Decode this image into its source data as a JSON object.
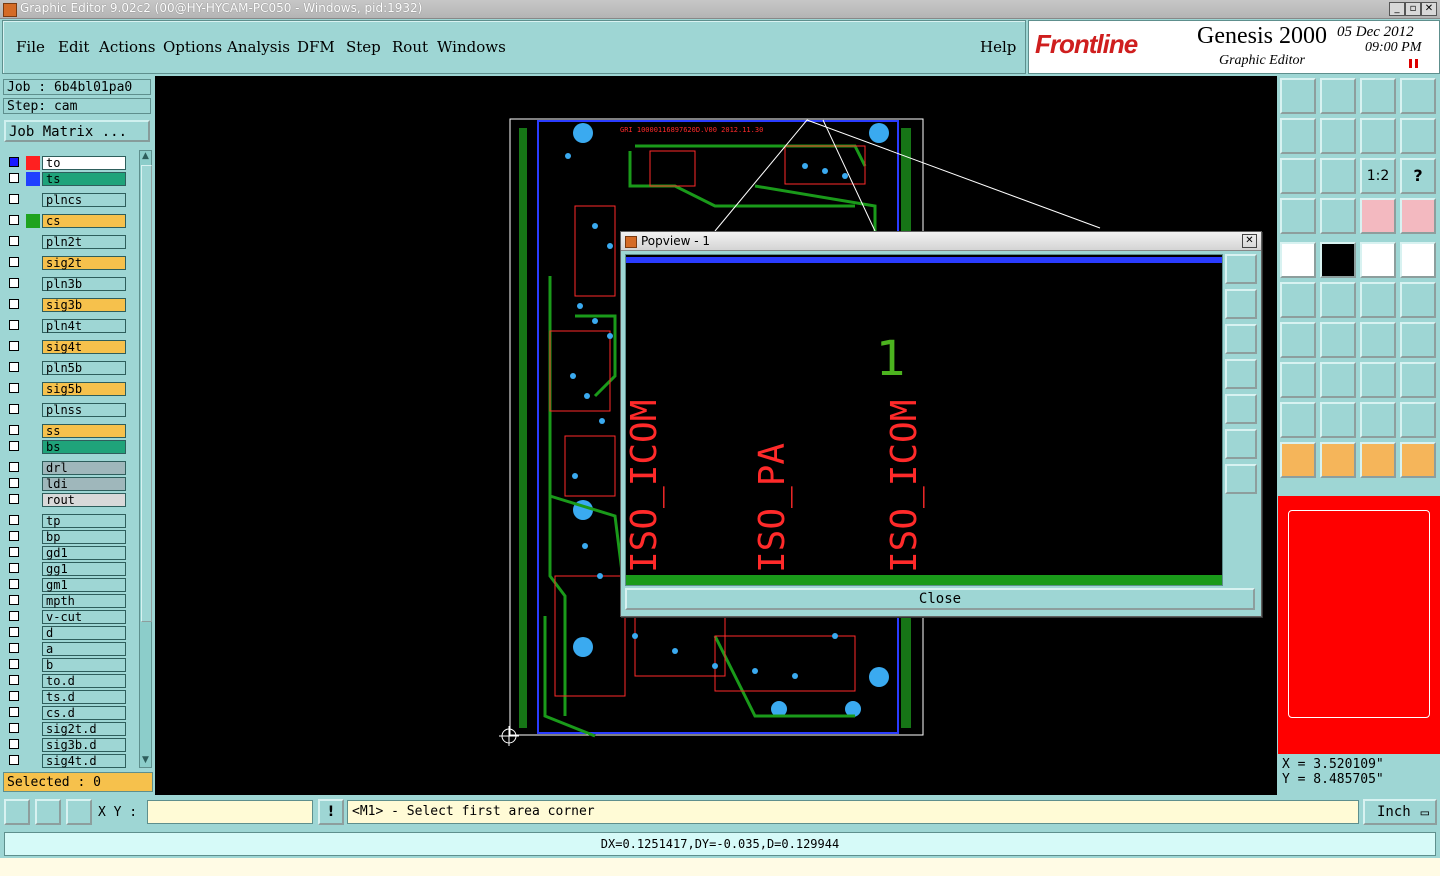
{
  "window": {
    "title": "Graphic Editor 9.02c2 (00@HY-HYCAM-PC050 - Windows, pid:1932)",
    "controls": [
      "minimize",
      "maximize",
      "close"
    ]
  },
  "menu": [
    "File",
    "Edit",
    "Actions",
    "Options",
    "Analysis",
    "DFM",
    "Step",
    "Rout",
    "Windows"
  ],
  "help_label": "Help",
  "brand": {
    "logo": "Frontline",
    "product": "Genesis 2000",
    "subtitle": "Graphic Editor",
    "date": "05 Dec 2012",
    "time": "09:00 PM"
  },
  "job": {
    "label": "Job : 6b4bl01pa0",
    "step": "Step: cam"
  },
  "job_matrix_label": "Job Matrix ...",
  "layers": [
    {
      "name": "to",
      "bg": "#ffffff",
      "swatch": "#ff2020",
      "checked": true
    },
    {
      "name": "ts",
      "bg": "#1fa37a",
      "swatch": "#2040ff",
      "checked": false
    },
    {
      "name": "plncs",
      "bg": "#9ed6d4",
      "swatch": "",
      "checked": false
    },
    {
      "name": "cs",
      "bg": "#f6c14c",
      "swatch": "#1fa31f",
      "checked": false
    },
    {
      "name": "pln2t",
      "bg": "#9ed6d4",
      "swatch": "",
      "checked": false
    },
    {
      "name": "sig2t",
      "bg": "#f6c14c",
      "swatch": "",
      "checked": false
    },
    {
      "name": "pln3b",
      "bg": "#9ed6d4",
      "swatch": "",
      "checked": false
    },
    {
      "name": "sig3b",
      "bg": "#f6c14c",
      "swatch": "",
      "checked": false
    },
    {
      "name": "pln4t",
      "bg": "#9ed6d4",
      "swatch": "",
      "checked": false
    },
    {
      "name": "sig4t",
      "bg": "#f6c14c",
      "swatch": "",
      "checked": false
    },
    {
      "name": "pln5b",
      "bg": "#9ed6d4",
      "swatch": "",
      "checked": false
    },
    {
      "name": "sig5b",
      "bg": "#f6c14c",
      "swatch": "",
      "checked": false
    },
    {
      "name": "plnss",
      "bg": "#9ed6d4",
      "swatch": "",
      "checked": false
    },
    {
      "name": "ss",
      "bg": "#f6c14c",
      "swatch": "",
      "checked": false
    },
    {
      "name": "bs",
      "bg": "#1fa37a",
      "swatch": "",
      "checked": false
    },
    {
      "name": "drl",
      "bg": "#9fb7bb",
      "swatch": "",
      "checked": false
    },
    {
      "name": "ldi",
      "bg": "#9fb7bb",
      "swatch": "",
      "checked": false
    },
    {
      "name": "rout",
      "bg": "#d9d9d9",
      "swatch": "",
      "checked": false
    },
    {
      "name": "tp",
      "bg": "#9ed6d4",
      "swatch": "",
      "checked": false
    },
    {
      "name": "bp",
      "bg": "#9ed6d4",
      "swatch": "",
      "checked": false
    },
    {
      "name": "gd1",
      "bg": "#9ed6d4",
      "swatch": "",
      "checked": false
    },
    {
      "name": "gg1",
      "bg": "#9ed6d4",
      "swatch": "",
      "checked": false
    },
    {
      "name": "gm1",
      "bg": "#9ed6d4",
      "swatch": "",
      "checked": false
    },
    {
      "name": "mpth",
      "bg": "#9ed6d4",
      "swatch": "",
      "checked": false
    },
    {
      "name": "v-cut",
      "bg": "#9ed6d4",
      "swatch": "",
      "checked": false
    },
    {
      "name": "d",
      "bg": "#9ed6d4",
      "swatch": "",
      "checked": false
    },
    {
      "name": "a",
      "bg": "#9ed6d4",
      "swatch": "",
      "checked": false
    },
    {
      "name": "b",
      "bg": "#9ed6d4",
      "swatch": "",
      "checked": false
    },
    {
      "name": "to.d",
      "bg": "#9ed6d4",
      "swatch": "",
      "checked": false
    },
    {
      "name": "ts.d",
      "bg": "#9ed6d4",
      "swatch": "",
      "checked": false
    },
    {
      "name": "cs.d",
      "bg": "#9ed6d4",
      "swatch": "",
      "checked": false
    },
    {
      "name": "sig2t.d",
      "bg": "#9ed6d4",
      "swatch": "",
      "checked": false
    },
    {
      "name": "sig3b.d",
      "bg": "#9ed6d4",
      "swatch": "",
      "checked": false
    },
    {
      "name": "sig4t.d",
      "bg": "#9ed6d4",
      "swatch": "",
      "checked": false
    }
  ],
  "selected_label": "Selected : 0",
  "pcb": {
    "header_text": "GRI 10000116897620D.V00 2012.11.30"
  },
  "popview": {
    "title": "Popview - 1",
    "texts": [
      "ISO_ICOM",
      "ISO_PA",
      "ISO_ICOM"
    ],
    "pin_number": "1",
    "close_label": "Close"
  },
  "tools": {
    "ratio_label": "1:2",
    "help_glyph": "?"
  },
  "coords": {
    "x": "X = 3.520109\"",
    "y": "Y = 8.485705\""
  },
  "command": {
    "xy_label": "X Y :",
    "xy_value": "",
    "bang": "!",
    "message": "<M1> - Select first area corner",
    "unit": "Inch"
  },
  "status": "DX=0.1251417,DY=-0.035,D=0.129944"
}
